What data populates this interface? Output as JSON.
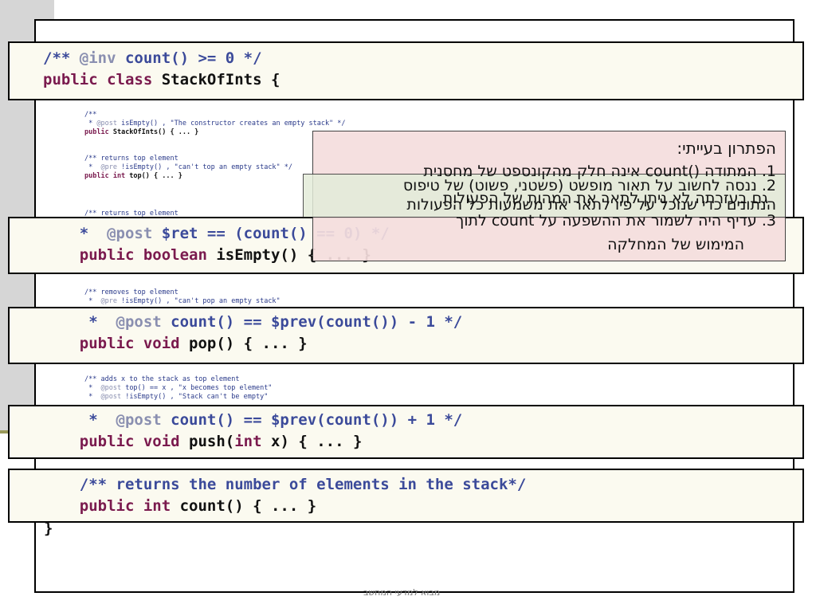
{
  "header": {
    "inv_line": "/** @inv count() >= 0 */",
    "inv_open": "/** ",
    "inv_tag": "@inv",
    "inv_rest": " count() >= 0 */",
    "class_kw": "public class",
    "class_name": " StackOfInts {"
  },
  "small_blocks": {
    "ctor_line1": "/**",
    "ctor_line2_pre": " * ",
    "ctor_line2_tag": "@post",
    "ctor_line2_rest": " isEmpty() , \"The constructor creates an empty stack\" */",
    "ctor_line3_kw": "public",
    "ctor_line3_rest": " StackOfInts() { ... }",
    "top_line1": "/** returns top element",
    "top_line2_pre": " *  ",
    "top_line2_tag": "@pre",
    "top_line2_rest": " !isEmpty() , \"can't top an empty stack\" */",
    "top_line3_kw": "public int",
    "top_line3_rest": " top() { ... }",
    "top2_line1": "/** returns top element",
    "pop_line1": "/** removes top element",
    "pop_line2_pre": " *  ",
    "pop_line2_tag": "@pre",
    "pop_line2_rest": " !isEmpty() , \"can't pop an empty stack\"",
    "push_line1": "/** adds x to the stack as top element",
    "push_line2_pre": " *  ",
    "push_line2_tag": "@post",
    "push_line2_rest": " top() == x , \"x becomes top element\"",
    "push_line3_pre": " *  ",
    "push_line3_tag": "@post",
    "push_line3_rest": " !isEmpty() , \"Stack can't be empty\""
  },
  "isEmpty_band": {
    "line1_pre": "    *  ",
    "line1_tag": "@post",
    "line1_rest": " $ret == (count() == 0) */",
    "line2_kw": "    public boolean",
    "line2_rest": " isEmpty() { ... }"
  },
  "pop_band": {
    "line1_pre": "     *  ",
    "line1_tag": "@post",
    "line1_rest": " count() == $prev(count()) - 1 */",
    "line2_kw": "    public void",
    "line2_rest": " pop() { ... }"
  },
  "push_band": {
    "line1_pre": "     *  ",
    "line1_tag": "@post",
    "line1_rest": " count() == $prev(count()) + 1 */",
    "line2_kw": "    public void",
    "line2_rest": " push(",
    "line2_kw2": "int",
    "line2_rest2": " x) { ... }"
  },
  "count_band": {
    "line1": "    /** returns the number of elements in the stack*/",
    "line2_kw": "    public int",
    "line2_rest": " count() { ... }"
  },
  "closing_brace": "}",
  "callout": {
    "title": "הפתרון בעייתי:",
    "item1_line1": "1.  המתודה ()count אינה חלק מהקונספט של מחסנית",
    "item2_line1": "2.  ננסה לחשוב על תאור מופשט (פשטני, פשוט) של טיפוס",
    "item2_line2": "הנתונים כדי שנוכל על פיו לתאר את משמעות כל הפעולות",
    "item3_line1": "3.  עדיף היה לשמור את ההשפעה על count לתוך",
    "item3_line2": "המימוש של המחלקה",
    "overlap_line": "גם בעזרתה לא ניתן לתאר את המהות של הפעולות"
  },
  "footer": "מבוא למדעי המחשב",
  "colors": {
    "band_bg": "#fbfaf0",
    "comment": "#3b4a9a",
    "keyword": "#7a1a4e",
    "annotation": "#8a8fb0",
    "callout_pink": "#f5dede",
    "callout_green": "#e3ecd9"
  }
}
